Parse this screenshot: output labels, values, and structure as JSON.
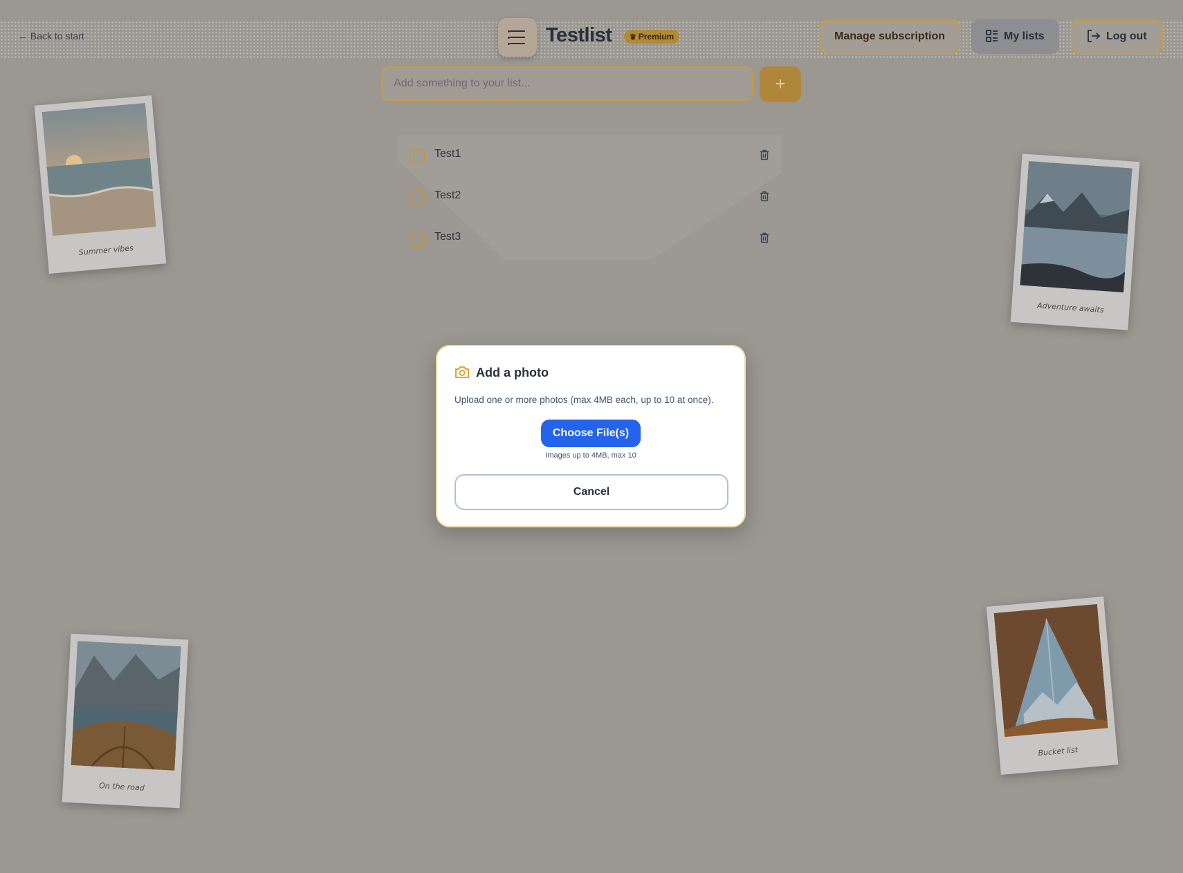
{
  "header": {
    "back_link": "← Back to start",
    "brand": "Testlist",
    "premium_badge": "Premium",
    "manage_subscription": "Manage subscription",
    "my_lists": "My lists",
    "log_out": "Log out"
  },
  "add_item": {
    "placeholder": "Add something to your list...",
    "button": "+"
  },
  "list": {
    "items": [
      {
        "label": "Test1"
      },
      {
        "label": "Test2"
      },
      {
        "label": "Test3"
      }
    ]
  },
  "polaroids": [
    {
      "caption": "Summer vibes"
    },
    {
      "caption": "Adventure awaits"
    },
    {
      "caption": "On the road"
    },
    {
      "caption": "Bucket list"
    }
  ],
  "modal": {
    "title": "Add a photo",
    "description": "Upload one or more photos (max 4MB each, up to 10 at once).",
    "choose_button": "Choose File(s)",
    "hint": "Images up to 4MB, max 10",
    "cancel_button": "Cancel"
  },
  "colors": {
    "accent": "#c89b42",
    "primary_button": "#2463eb",
    "overlay_bg": "#9b9892"
  }
}
